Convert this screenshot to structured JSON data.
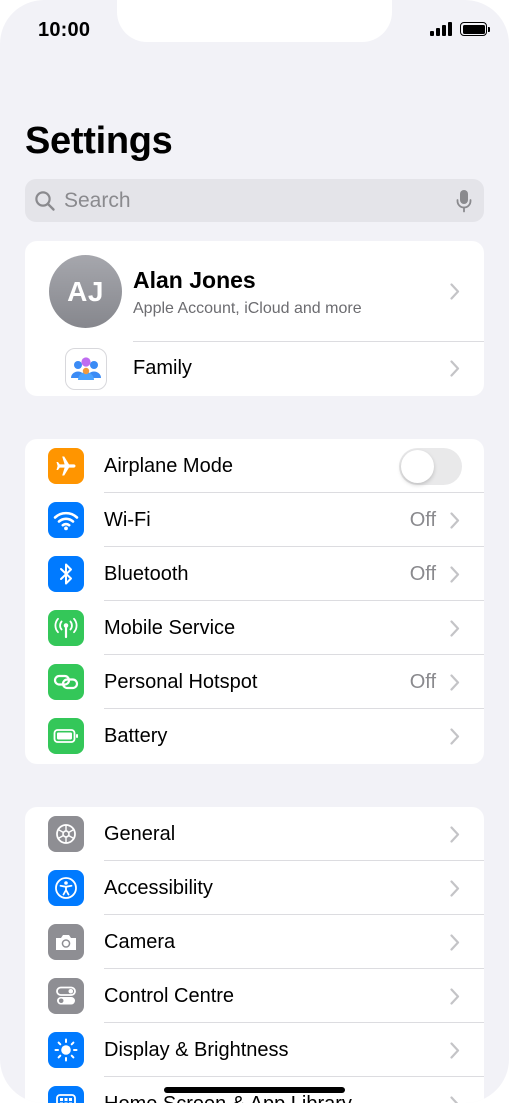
{
  "status_bar": {
    "time": "10:00"
  },
  "page": {
    "title": "Settings"
  },
  "search": {
    "placeholder": "Search"
  },
  "profile": {
    "initials": "AJ",
    "name": "Alan Jones",
    "subtitle": "Apple Account, iCloud and more"
  },
  "family": {
    "label": "Family"
  },
  "connectivity": {
    "airplane_mode": {
      "label": "Airplane Mode",
      "icon": "airplane-icon",
      "color": "#ff9500",
      "toggle_on": false
    },
    "wifi": {
      "label": "Wi-Fi",
      "value": "Off",
      "icon": "wifi-icon",
      "color": "#007aff"
    },
    "bluetooth": {
      "label": "Bluetooth",
      "value": "Off",
      "icon": "bluetooth-icon",
      "color": "#007aff"
    },
    "mobile_service": {
      "label": "Mobile Service",
      "icon": "antenna-icon",
      "color": "#34c759"
    },
    "personal_hotspot": {
      "label": "Personal Hotspot",
      "value": "Off",
      "icon": "hotspot-link-icon",
      "color": "#34c759"
    },
    "battery": {
      "label": "Battery",
      "icon": "battery-icon",
      "color": "#34c759"
    }
  },
  "system": {
    "general": {
      "label": "General",
      "icon": "gear-icon",
      "color": "#8e8e93"
    },
    "accessibility": {
      "label": "Accessibility",
      "icon": "accessibility-icon",
      "color": "#007aff"
    },
    "camera": {
      "label": "Camera",
      "icon": "camera-icon",
      "color": "#8e8e93"
    },
    "control_centre": {
      "label": "Control Centre",
      "icon": "toggles-icon",
      "color": "#8e8e93"
    },
    "display_brightness": {
      "label": "Display & Brightness",
      "icon": "sun-icon",
      "color": "#007aff"
    },
    "home_screen": {
      "label": "Home Screen & App Library",
      "icon": "app-grid-icon",
      "color": "#007aff"
    }
  }
}
